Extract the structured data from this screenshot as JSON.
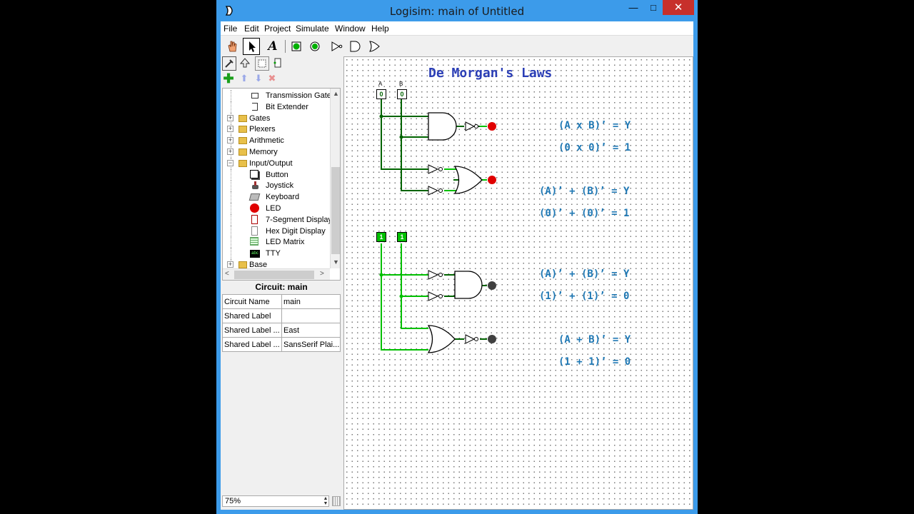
{
  "window": {
    "title": "Logisim: main of Untitled",
    "minimize": "—",
    "maximize": "□",
    "close": "✕"
  },
  "menu": [
    "File",
    "Edit",
    "Project",
    "Simulate",
    "Window",
    "Help"
  ],
  "toolbar": {
    "text_tool": "A"
  },
  "tree": {
    "items": [
      {
        "label": "Transmission Gate",
        "level": 2
      },
      {
        "label": "Bit Extender",
        "level": 2
      },
      {
        "label": "Gates",
        "level": 1
      },
      {
        "label": "Plexers",
        "level": 1
      },
      {
        "label": "Arithmetic",
        "level": 1
      },
      {
        "label": "Memory",
        "level": 1
      },
      {
        "label": "Input/Output",
        "level": 1
      },
      {
        "label": "Button",
        "level": 2
      },
      {
        "label": "Joystick",
        "level": 2
      },
      {
        "label": "Keyboard",
        "level": 2
      },
      {
        "label": "LED",
        "level": 2
      },
      {
        "label": "7-Segment Display",
        "level": 2
      },
      {
        "label": "Hex Digit Display",
        "level": 2
      },
      {
        "label": "LED Matrix",
        "level": 2
      },
      {
        "label": "TTY",
        "level": 2
      },
      {
        "label": "Base",
        "level": 1
      }
    ],
    "tty_icon_text": "abc"
  },
  "attributes": {
    "title": "Circuit: main",
    "rows": [
      {
        "name": "Circuit Name",
        "value": "main"
      },
      {
        "name": "Shared Label",
        "value": ""
      },
      {
        "name": "Shared Label ...",
        "value": "East"
      },
      {
        "name": "Shared Label ...",
        "value": "SansSerif Plai..."
      }
    ]
  },
  "zoom": "75%",
  "canvas": {
    "title": "De Morgan's Laws",
    "pin_labels": {
      "a": "A",
      "b": "B"
    },
    "top_pins": [
      "0",
      "0"
    ],
    "bottom_pins": [
      "1",
      "1"
    ],
    "equations": [
      "(A x B)’ = Y",
      "(0 x 0)’ = 1",
      "(A)’ + (B)’ = Y",
      "(0)’ + (0)’ = 1",
      "(A)’ + (B)’ = Y",
      "(1)’ + (1)’ = 0",
      "(A + B)’ = Y",
      "(1 + 1)’ = 0"
    ]
  },
  "colors": {
    "wire_on": "#00c000",
    "wire_off": "#006400",
    "led_on": "#e00000",
    "led_off": "#404040",
    "equation": "#1f78b4",
    "title": "#2b3eb6"
  }
}
